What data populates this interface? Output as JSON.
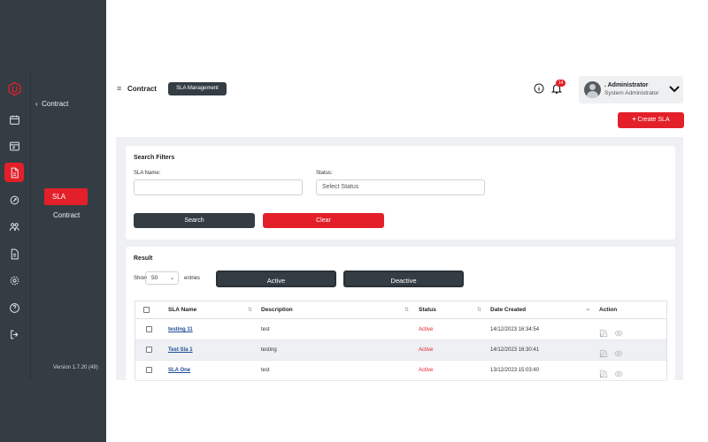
{
  "sidebar": {
    "section": "Contract",
    "items": [
      {
        "label": "SLA",
        "active": true
      },
      {
        "label": "Contract",
        "active": false
      }
    ],
    "version": "Version 1.7.20 (49)"
  },
  "header": {
    "breadcrumb": "Contract",
    "page_pill": "SLA Management",
    "notification_count": "14",
    "user_name": ". Administrator",
    "user_role": "System Administrator"
  },
  "actions": {
    "create_label": "Create SLA"
  },
  "filters": {
    "title": "Search Filters",
    "sla_name_label": "SLA Name:",
    "sla_name_value": "",
    "status_label": "Status:",
    "status_placeholder": "Select Status",
    "search_label": "Search",
    "clear_label": "Clear"
  },
  "result": {
    "title": "Result",
    "show_label": "Show",
    "page_size": "50",
    "entries_label": "entries",
    "active_label": "Active",
    "deactive_label": "Deactive",
    "columns": [
      "SLA Name",
      "Description",
      "Status",
      "Date Created",
      "Action"
    ],
    "rows": [
      {
        "name": "testing 11",
        "description": "test",
        "status": "Active",
        "date": "14/12/2023 16:34:54"
      },
      {
        "name": "Test Sla 1",
        "description": "testing",
        "status": "Active",
        "date": "14/12/2023 16:30:41"
      },
      {
        "name": "SLA One",
        "description": "test",
        "status": "Active",
        "date": "13/12/2023 15:03:40"
      }
    ]
  },
  "colors": {
    "accent": "#e3202a",
    "sidebar": "#343d44",
    "link": "#1c4d96"
  }
}
